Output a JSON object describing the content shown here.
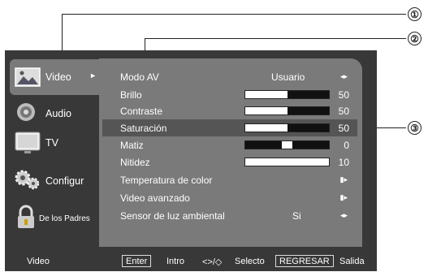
{
  "callouts": [
    "①",
    "②",
    "③"
  ],
  "sidebar": {
    "items": [
      {
        "label": "Video",
        "icon": "video-picture-icon",
        "active": true
      },
      {
        "label": "Audio",
        "icon": "speaker-icon"
      },
      {
        "label": "TV",
        "icon": "tv-icon"
      },
      {
        "label": "Configur",
        "icon": "gears-icon"
      },
      {
        "label": "De los Padres",
        "icon": "lock-icon"
      }
    ],
    "active_arrow": "►"
  },
  "menu": {
    "rows": [
      {
        "label": "Modo AV",
        "value": "Usuario",
        "arrow": "◂▸"
      },
      {
        "label": "Brillo",
        "level": 50,
        "center_marker": false,
        "number": "50"
      },
      {
        "label": "Contraste",
        "level": 50,
        "center_marker": false,
        "number": "50"
      },
      {
        "label": "Saturación",
        "level": 50,
        "center_marker": false,
        "number": "50",
        "highlighted": true
      },
      {
        "label": "Matiz",
        "level": 0,
        "center_marker": true,
        "number": "0"
      },
      {
        "label": "Nitidez",
        "level": 100,
        "center_marker": false,
        "number": "10"
      },
      {
        "label": "Temperatura de color",
        "arrow": "▮▸"
      },
      {
        "label": "Video avanzado",
        "arrow": "▮▸"
      },
      {
        "label": "Sensor de luz ambiental",
        "value": "Si",
        "arrow": "◂▸"
      }
    ]
  },
  "footer": {
    "section": "Video",
    "enter_key": "Enter",
    "enter_label": "Intro",
    "nav_keys": "<>/◇",
    "nav_label": "Selecto",
    "return_key": "REGRESAR",
    "return_label": "Salida"
  }
}
